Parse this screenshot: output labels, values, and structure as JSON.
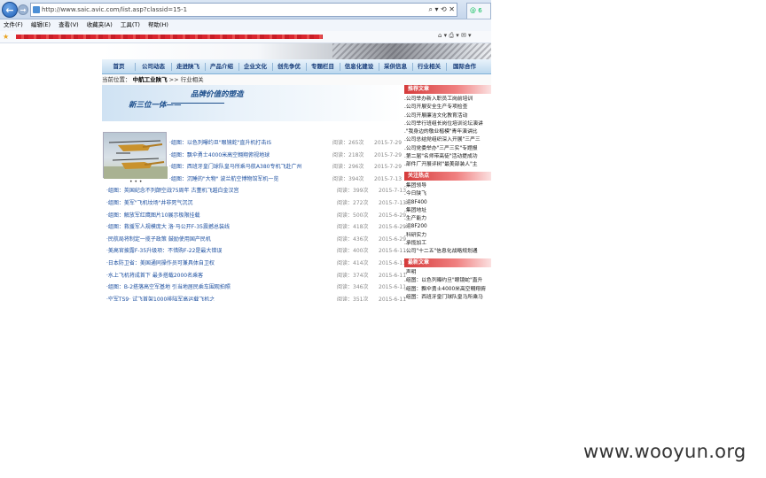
{
  "browser": {
    "url": "http://www.saic.avic.com/list.asp?classid=15-1",
    "url_buttons": "⌕ ▾ ⟲ ✕",
    "tab_label": "@ 6",
    "menu": [
      "文件(F)",
      "编辑(E)",
      "查看(V)",
      "收藏夹(A)",
      "工具(T)",
      "帮助(H)"
    ],
    "toolbar_icons": "⌂ ▾ ⎙ ▾ ✉ ▾"
  },
  "site": {
    "nav": [
      "首页",
      "公司动态",
      "走进陕飞",
      "产品介绍",
      "企业文化",
      "创先争优",
      "专题栏目",
      "信息化建设",
      "采供信息",
      "行业相关",
      "国际合作"
    ],
    "breadcrumb_prefix": "当前位置：",
    "breadcrumb_home": "中航工业陕飞",
    "breadcrumb_sep": ">>",
    "breadcrumb_current": "行业相关",
    "hero_line1": "品牌价值的塑造",
    "hero_line2": "新三位一体——",
    "photo_dots": "• • •",
    "news": [
      {
        "title": "·组图：以色列曝约旦\"眼镜蛇\"直升机打击IS",
        "read": "阅读：265次",
        "date": "2015-7-29"
      },
      {
        "title": "·组图：飘伞勇士4000米高空翱翔俯视地球",
        "read": "阅读：218次",
        "date": "2015-7-29"
      },
      {
        "title": "·组图：西班牙皇门球队皇马所乘马航A380专机飞赴广州",
        "read": "阅读：296次",
        "date": "2015-7-29"
      },
      {
        "title": "·组图：沉睡的\"大物\" 波兰航空博物馆军机一览",
        "read": "阅读：394次",
        "date": "2015-7-13"
      },
      {
        "title": "·组图：英国纪念不列颠空战75周年 古董机飞越白金汉宫",
        "read": "阅读：399次",
        "date": "2015-7-13"
      },
      {
        "title": "·组图：美军\"飞机坟场\"井非死气沉沉",
        "read": "阅读：272次",
        "date": "2015-7-13"
      },
      {
        "title": "·组图：解放军红鹰图片10展示极限挂载",
        "read": "阅读：500次",
        "date": "2015-6-29"
      },
      {
        "title": "·组图：救援军人规模庞大 洛·马公开F-35震撼总装线",
        "read": "阅读：418次",
        "date": "2015-6-29"
      },
      {
        "title": "·民航局将制定一揽子政策 鼓励使用国产民机",
        "read": "阅读：436次",
        "date": "2015-6-29"
      },
      {
        "title": "·美高官披露F-35升级项：不惜购F-22是最大错误",
        "read": "阅读：400次",
        "date": "2015-6-11"
      },
      {
        "title": "·日本防卫省：美国通同操作员可兼具体自卫权",
        "read": "阅读：414次",
        "date": "2015-6-11"
      },
      {
        "title": "·水上飞机将成首下 最多搭载2000名乘客",
        "read": "阅读：374次",
        "date": "2015-6-11"
      },
      {
        "title": "·组图：B-2搭落高空军基地 引当地居民乘车围观拍照",
        "read": "阅读：346次",
        "date": "2015-6-11"
      },
      {
        "title": "·空军TS9· 试飞首架1000排陆军高运载飞机之",
        "read": "阅读：351次",
        "date": "2015-6-11"
      }
    ],
    "sidebar": [
      {
        "heading": "推荐文章",
        "items": [
          ".公司举办新入职员工岗前培训",
          ".公司开展安全生产专项检查",
          ".公司开展廉洁文化教育活动",
          ".公司举行班组长岗位培训论坛演讲",
          ".\"我身边的敬业楷模\"青年演讲比",
          ".公司总结党组织深入开展\"三严三",
          ".公司党委举办\"三严三实\"专题报",
          ".第二届\"名师带高徒\"活动提成功",
          ".部件厂开展评树\"最美部装人\"主"
        ]
      },
      {
        "heading": "关注热点",
        "items": [
          ".集团领导",
          ".今日陕飞",
          ".运8F400",
          ".集团地址",
          ".生产能力",
          ".运8F200",
          ".科研实力",
          ".承揽加工",
          ".公司\"十二五\"信息化战略规划通"
        ]
      },
      {
        "heading": "最新文章",
        "items": [
          ".声明",
          ".组图：以色列曝约旦\"眼镜蛇\"直升",
          ".组图：飘伞勇士4000米高空翱翔俯",
          ".组图：西班牙皇门球队皇马所乘马"
        ]
      }
    ]
  },
  "watermark": "www.wooyun.org"
}
